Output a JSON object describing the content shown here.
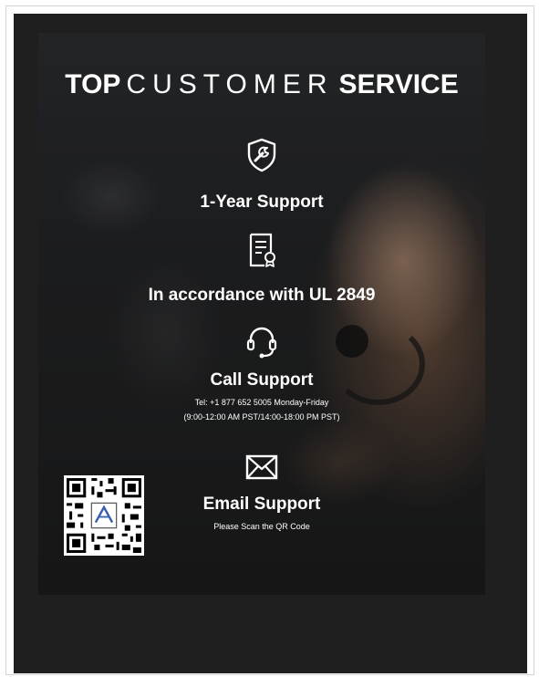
{
  "title": {
    "prefix": "TOP",
    "middle": "CUSTOMER",
    "suffix": "SERVICE"
  },
  "features": {
    "support": {
      "label": "1-Year Support",
      "icon": "shield-wrench-icon"
    },
    "compliance": {
      "label": "In accordance with UL 2849",
      "icon": "certificate-icon"
    },
    "call": {
      "label": "Call Support",
      "icon": "headset-icon",
      "phone_line": "Tel: +1 877 652 5005  Monday-Friday",
      "hours_line": "(9:00-12:00 AM PST/14:00-18:00 PM PST)"
    },
    "email": {
      "label": "Email Support",
      "icon": "envelope-icon",
      "note": "Please Scan the QR Code"
    }
  },
  "qr_code": {
    "icon": "qr-code-icon"
  },
  "colors": {
    "background": "#1f1f1f",
    "text": "#ffffff"
  }
}
